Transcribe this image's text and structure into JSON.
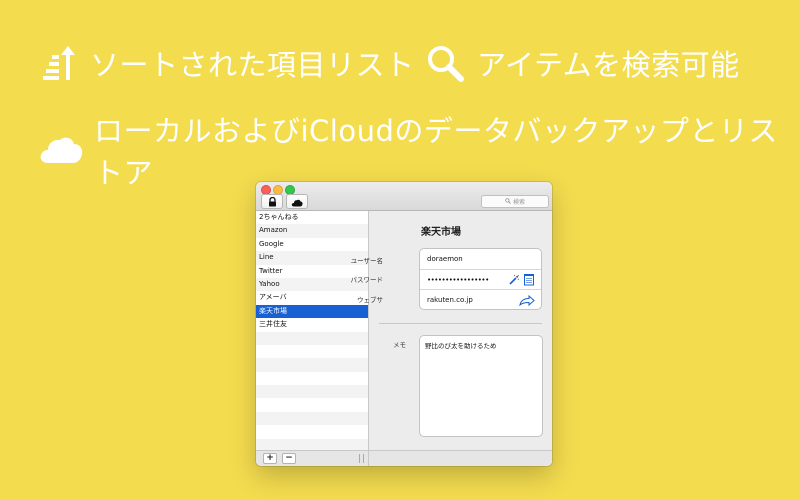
{
  "features": {
    "sorted": "ソートされた項目リスト",
    "search": "アイテムを検索可能",
    "backup": "ローカルおよびiCloudのデータバックアップとリストア"
  },
  "toolbar": {
    "search_placeholder": "検索"
  },
  "items": [
    "2ちゃんねる",
    "Amazon",
    "Google",
    "Line",
    "Twitter",
    "Yahoo",
    "アメーバ",
    "楽天市場",
    "三井住友"
  ],
  "selected_item": "楽天市場",
  "detail": {
    "title": "楽天市場",
    "username_label": "ユーザー名",
    "username": "doraemon",
    "password_label": "パスワード",
    "password": "•••••••••••••••••",
    "website_label": "ウェブサ",
    "website": "rakuten.co.jp",
    "memo_label": "メモ",
    "memo": "野比のび太を助けるため"
  },
  "bottom": {
    "add": "+",
    "remove": "−"
  },
  "colors": {
    "background": "#f4dc4f",
    "selection": "#1761d4"
  }
}
